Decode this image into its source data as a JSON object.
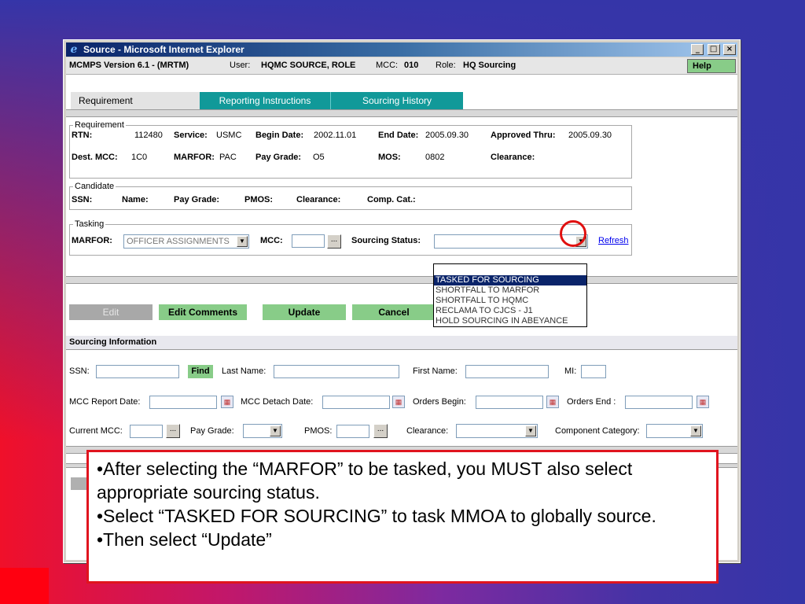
{
  "window": {
    "title": "Source - Microsoft Internet Explorer",
    "min_glyph": "_",
    "max_glyph": "□",
    "close_glyph": "×"
  },
  "header": {
    "app_version": "MCMPS Version 6.1 - (MRTM)",
    "user_label": "User:",
    "user_value": "HQMC SOURCE, ROLE",
    "mcc_label": "MCC:",
    "mcc_value": "010",
    "role_label": "Role:",
    "role_value": "HQ Sourcing",
    "help_label": "Help"
  },
  "tabs": [
    {
      "label": "Requirement",
      "active": true
    },
    {
      "label": "Reporting Instructions",
      "active": false
    },
    {
      "label": "Sourcing History",
      "active": false
    }
  ],
  "requirement": {
    "legend": "Requirement",
    "rtn_label": "RTN:",
    "rtn_value": "112480",
    "service_label": "Service:",
    "service_value": "USMC",
    "begin_label": "Begin Date:",
    "begin_value": "2002.11.01",
    "end_label": "End Date:",
    "end_value": "2005.09.30",
    "approved_label": "Approved Thru:",
    "approved_value": "2005.09.30",
    "dest_label": "Dest. MCC:",
    "dest_value": "1C0",
    "marfor_label": "MARFOR:",
    "marfor_value": "PAC",
    "paygrade_label": "Pay Grade:",
    "paygrade_value": "O5",
    "mos_label": "MOS:",
    "mos_value": "0802",
    "clearance_label": "Clearance:"
  },
  "candidate": {
    "legend": "Candidate",
    "ssn_label": "SSN:",
    "name_label": "Name:",
    "paygrade_label": "Pay Grade:",
    "pmos_label": "PMOS:",
    "clearance_label": "Clearance:",
    "compcat_label": "Comp. Cat.:"
  },
  "tasking": {
    "legend": "Tasking",
    "marfor_label": "MARFOR:",
    "marfor_value": "OFFICER ASSIGNMENTS",
    "mcc_label": "MCC:",
    "ellipsis": "...",
    "sourcing_status_label": "Sourcing Status:",
    "refresh_label": "Refresh",
    "arrow_glyph": "▼"
  },
  "status_options": [
    {
      "label": ""
    },
    {
      "label": "TASKED FOR SOURCING"
    },
    {
      "label": "SHORTFALL TO MARFOR"
    },
    {
      "label": "SHORTFALL TO HQMC"
    },
    {
      "label": "RECLAMA TO CJCS - J1"
    },
    {
      "label": "HOLD SOURCING IN ABEYANCE"
    }
  ],
  "selected_status_index": 1,
  "actions": {
    "edit": "Edit",
    "edit_comments": "Edit Comments",
    "update": "Update",
    "cancel": "Cancel"
  },
  "sourcing": {
    "title": "Sourcing Information",
    "ssn_label": "SSN:",
    "find_label": "Find",
    "last_name_label": "Last Name:",
    "first_name_label": "First Name:",
    "mi_label": "MI:",
    "mcc_report_label": "MCC Report Date:",
    "mcc_detach_label": "MCC Detach Date:",
    "orders_begin_label": "Orders Begin:",
    "orders_end_label": "Orders End :",
    "current_mcc_label": "Current MCC:",
    "pay_grade_label": "Pay Grade:",
    "pmos_label": "PMOS:",
    "clearance_label": "Clearance:",
    "component_label": "Component Category:",
    "ellipsis": "...",
    "arrow_glyph": "▼",
    "cal_glyph": "▦"
  },
  "instructions": [
    "•After selecting the “MARFOR” to be tasked, you MUST also select appropriate sourcing status.",
    "•Select “TASKED FOR SOURCING” to task MMOA to globally source.",
    "•Then select “Update”"
  ],
  "colors": {
    "action_green": "#88cc88",
    "tab_teal": "#119999",
    "highlight_red": "#e01010",
    "selection_navy": "#0a246a"
  }
}
